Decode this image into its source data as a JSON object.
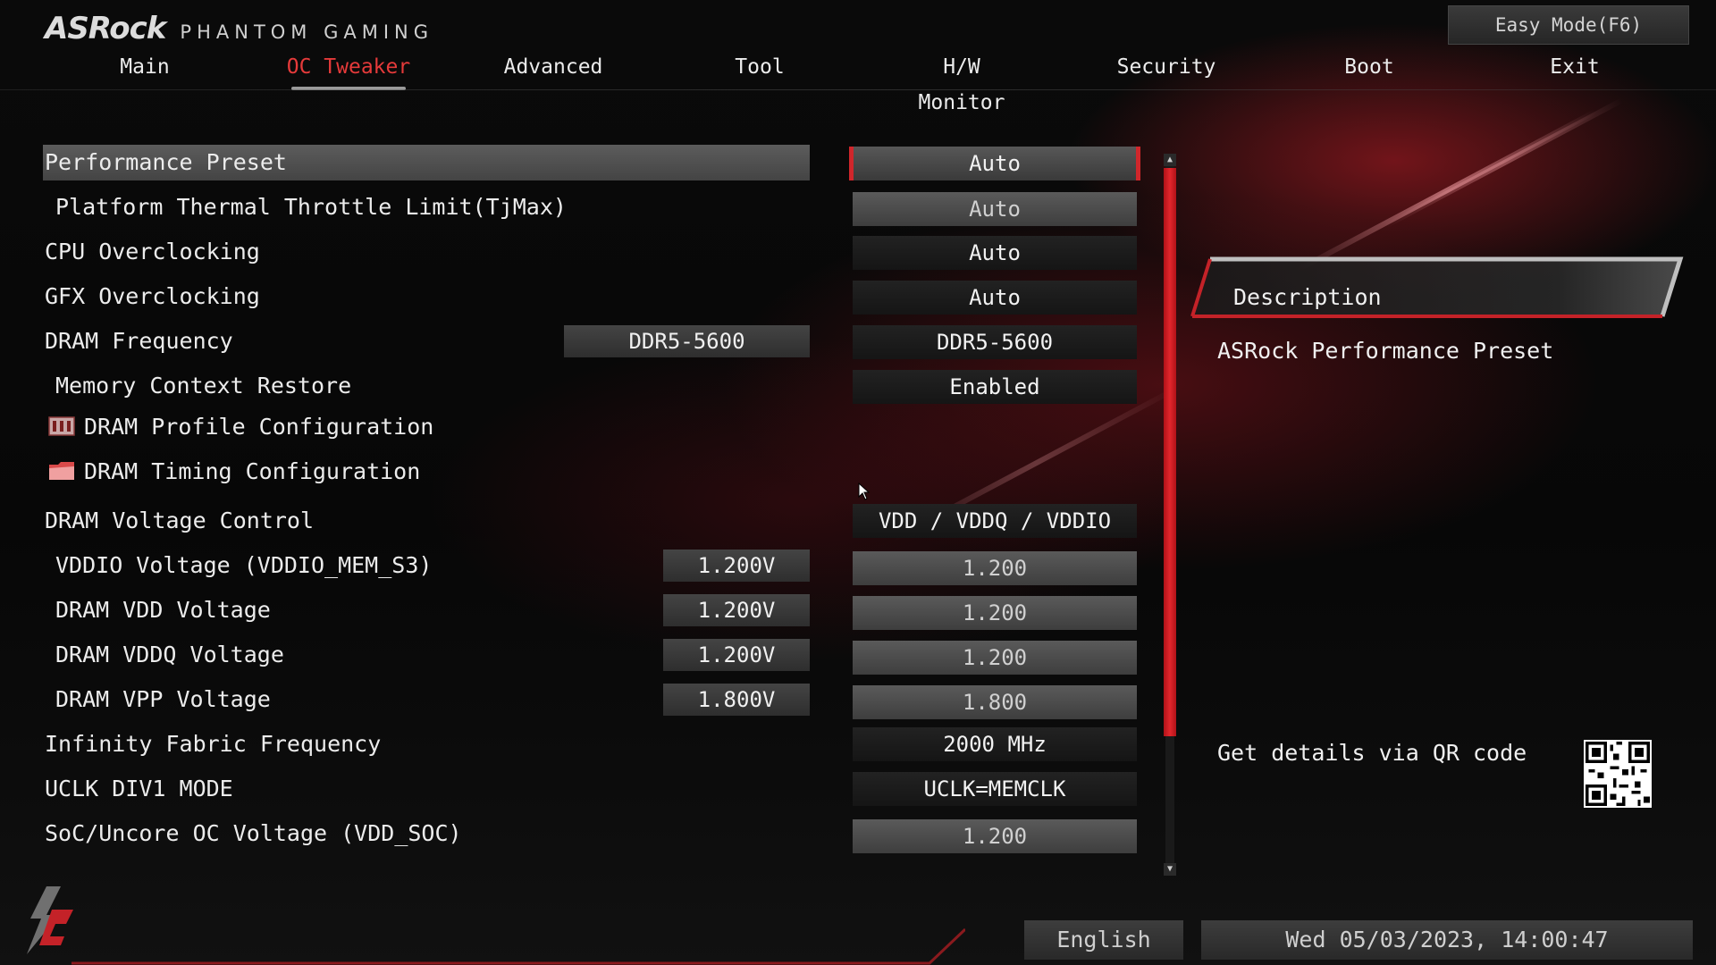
{
  "header": {
    "brand": "ASRock",
    "brand_sub": "PHANTOM GAMING",
    "easy_mode_label": "Easy Mode(F6)"
  },
  "tabs": [
    {
      "label": "Main",
      "active": false
    },
    {
      "label": "OC Tweaker",
      "active": true
    },
    {
      "label": "Advanced",
      "active": false
    },
    {
      "label": "Tool",
      "active": false
    },
    {
      "label": "H/W Monitor",
      "active": false
    },
    {
      "label": "Security",
      "active": false
    },
    {
      "label": "Boot",
      "active": false
    },
    {
      "label": "Exit",
      "active": false
    }
  ],
  "settings": [
    {
      "label": "Performance Preset",
      "value": "Auto",
      "selected": true
    },
    {
      "label": "Platform Thermal Throttle Limit(TjMax)",
      "value": "Auto"
    },
    {
      "label": "CPU Overclocking",
      "value": "Auto"
    },
    {
      "label": "GFX Overclocking",
      "value": "Auto"
    },
    {
      "label": "DRAM Frequency",
      "current": "DDR5-5600",
      "value": "DDR5-5600"
    },
    {
      "label": "Memory Context Restore",
      "value": "Enabled"
    },
    {
      "label": "DRAM Profile Configuration",
      "icon": "memory-icon"
    },
    {
      "label": "DRAM Timing Configuration",
      "icon": "folder-icon"
    },
    {
      "label": "DRAM Voltage Control",
      "value": "VDD / VDDQ / VDDIO"
    },
    {
      "label": "VDDIO Voltage (VDDIO_MEM_S3)",
      "current": "1.200V",
      "value": "1.200"
    },
    {
      "label": "DRAM VDD Voltage",
      "current": "1.200V",
      "value": "1.200"
    },
    {
      "label": "DRAM VDDQ Voltage",
      "current": "1.200V",
      "value": "1.200"
    },
    {
      "label": "DRAM VPP Voltage",
      "current": "1.800V",
      "value": "1.800"
    },
    {
      "label": "Infinity Fabric Frequency",
      "value": "2000 MHz"
    },
    {
      "label": "UCLK DIV1 MODE",
      "value": "UCLK=MEMCLK"
    },
    {
      "label": "SoC/Uncore OC Voltage (VDD_SOC)",
      "value": "1.200"
    }
  ],
  "description": {
    "title": "Description",
    "text": "ASRock Performance Preset",
    "qr_text": "Get details via QR code"
  },
  "footer": {
    "language": "English",
    "datetime": "Wed 05/03/2023, 14:00:47"
  },
  "colors": {
    "accent_red": "#e53a3a",
    "scroll_red": "#d0262b"
  }
}
